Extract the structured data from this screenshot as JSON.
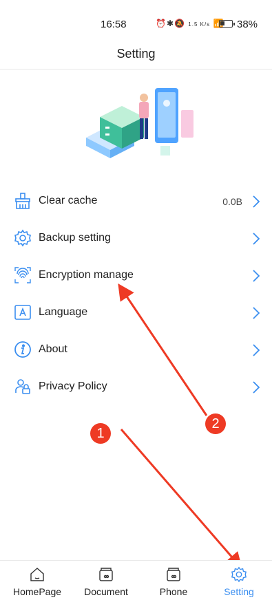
{
  "status_bar": {
    "time": "16:58",
    "icons_text": "⏰✱🔕",
    "network_speed": "1.5 K/s",
    "battery_percent": "38%",
    "battery_level": 0.38
  },
  "header": {
    "title": "Setting"
  },
  "menu": {
    "items": [
      {
        "label": "Clear cache",
        "value": "0.0B",
        "icon": "broom-icon"
      },
      {
        "label": "Backup setting",
        "icon": "gear-icon"
      },
      {
        "label": "Encryption manage",
        "icon": "fingerprint-icon"
      },
      {
        "label": "Language",
        "icon": "language-icon"
      },
      {
        "label": "About",
        "icon": "info-icon"
      },
      {
        "label": "Privacy Policy",
        "icon": "user-lock-icon"
      }
    ]
  },
  "tabbar": {
    "tabs": [
      {
        "label": "HomePage",
        "icon": "home-icon",
        "active": false
      },
      {
        "label": "Document",
        "icon": "folder-icon",
        "active": false
      },
      {
        "label": "Phone",
        "icon": "phone-folder-icon",
        "active": false
      },
      {
        "label": "Setting",
        "icon": "gear-icon",
        "active": true
      }
    ]
  },
  "annotations": {
    "badge_1": "1",
    "badge_2": "2"
  },
  "colors": {
    "accent": "#3a8ef0",
    "annotation": "#ee3a24",
    "divider": "#e6e6e6"
  }
}
